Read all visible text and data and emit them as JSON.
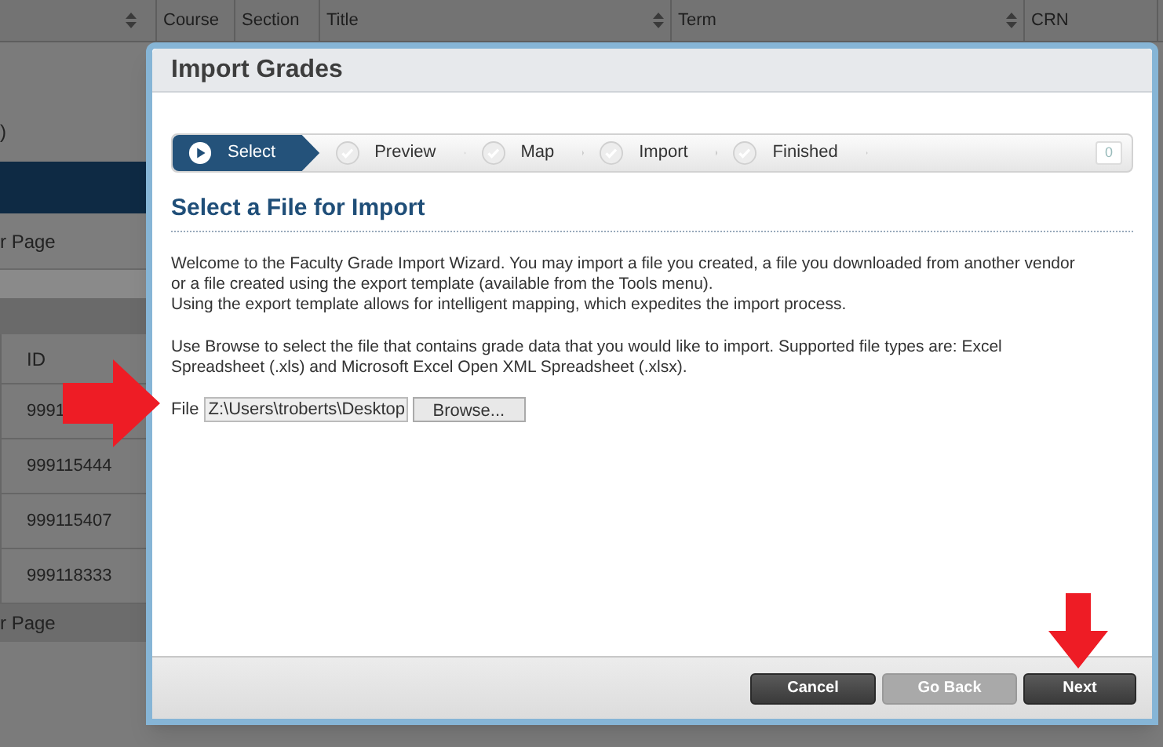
{
  "background": {
    "columns": [
      {
        "label": "Course",
        "sortable": false
      },
      {
        "label": "Section",
        "sortable": false
      },
      {
        "label": "Title",
        "sortable": true
      },
      {
        "label": "Term",
        "sortable": true
      },
      {
        "label": "CRN",
        "sortable": false
      }
    ],
    "fragment": ")",
    "per_page_top": "r Page",
    "id_header": "ID",
    "ids": [
      "9991",
      "999115444",
      "999115407",
      "999118333"
    ],
    "per_page_bottom": "r Page"
  },
  "dialog": {
    "title": "Import Grades",
    "steps": [
      {
        "label": "Select",
        "selected": true
      },
      {
        "label": "Preview",
        "selected": false
      },
      {
        "label": "Map",
        "selected": false
      },
      {
        "label": "Import",
        "selected": false
      },
      {
        "label": "Finished",
        "selected": false
      }
    ],
    "step_counter": "0",
    "heading": "Select a File for Import",
    "paragraphs": [
      [
        "Welcome to the Faculty Grade Import Wizard. You may import a file you created, a file you downloaded from another vendor or a file created using the export template (available from the Tools menu).",
        "Using the export template allows for intelligent mapping, which expedites the import process."
      ],
      [
        "Use Browse to select the file that contains grade data that you would like to import. Supported file types are: Excel Spreadsheet (.xls) and Microsoft Excel Open XML Spreadsheet (.xlsx)."
      ]
    ],
    "file_label": "File",
    "file_value": "Z:\\Users\\troberts\\Desktop",
    "browse": "Browse...",
    "buttons": [
      {
        "label": "Cancel",
        "disabled": false
      },
      {
        "label": "Go Back",
        "disabled": true
      },
      {
        "label": "Next",
        "disabled": false
      }
    ]
  }
}
